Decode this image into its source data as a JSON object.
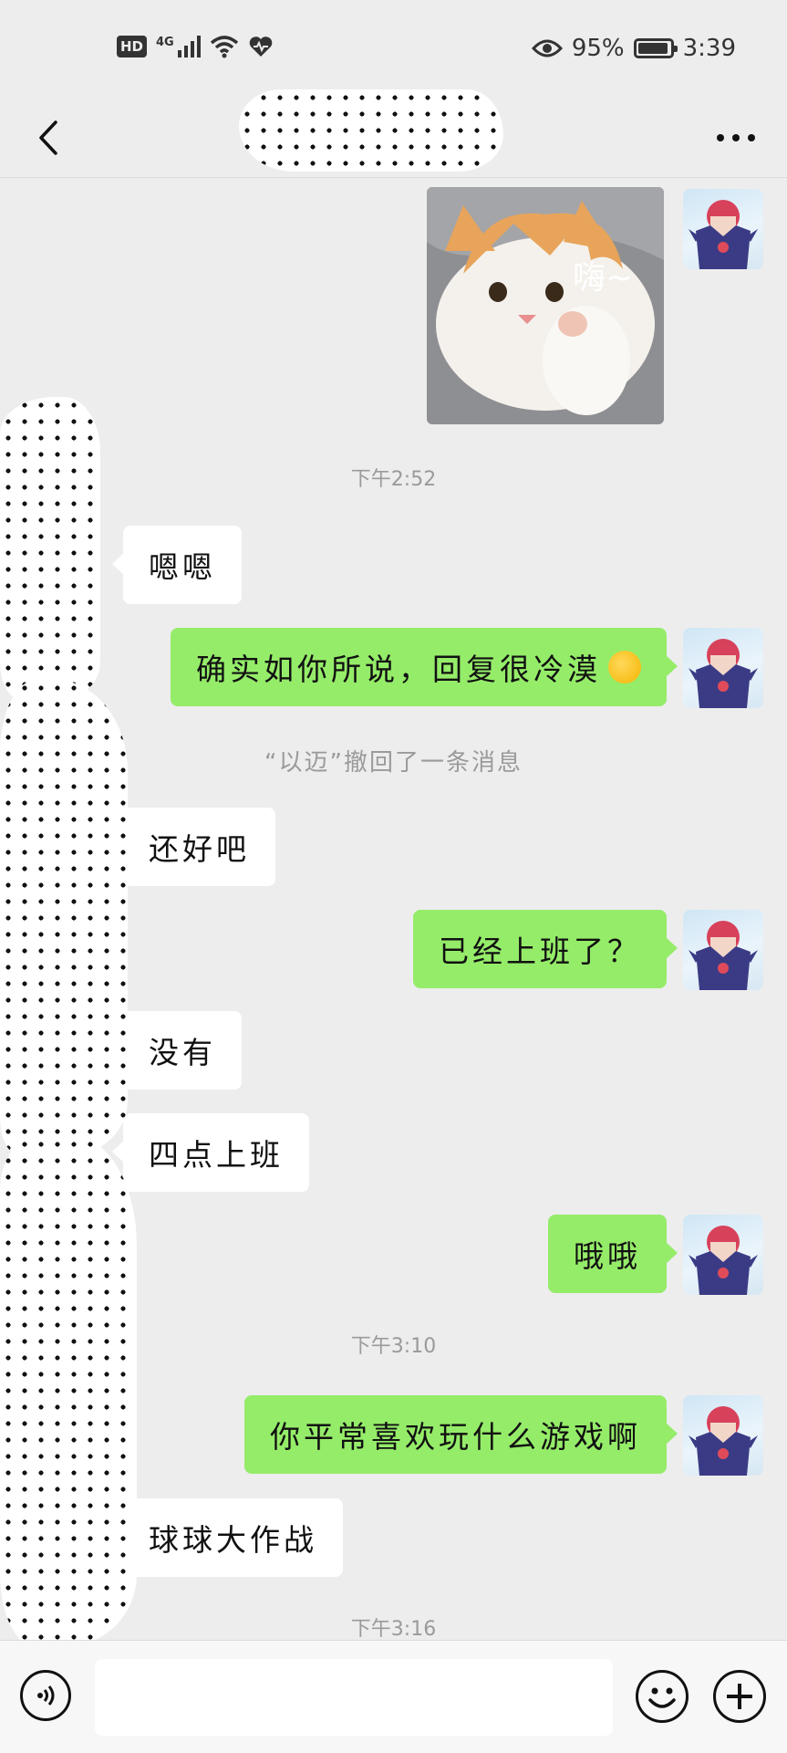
{
  "status_bar": {
    "hd": "HD",
    "network": "4G",
    "battery_percent": "95%",
    "battery_level": 0.95,
    "time": "3:39",
    "icons": [
      "hd-icon",
      "signal-icon",
      "wifi-icon",
      "heart-icon",
      "eye-icon",
      "battery-icon"
    ]
  },
  "header": {
    "title": "",
    "back_icon": "chevron-left-icon",
    "more_icon": "more-icon"
  },
  "messages": [
    {
      "type": "image",
      "side": "me",
      "caption": "嗨~"
    },
    {
      "type": "timestamp",
      "text": "下午2:52"
    },
    {
      "type": "text",
      "side": "them",
      "text": "嗯嗯"
    },
    {
      "type": "text",
      "side": "me",
      "text": "确实如你所说，回复很冷漠"
    },
    {
      "type": "system",
      "name": "“以迈”",
      "text": "撤回了一条消息"
    },
    {
      "type": "text",
      "side": "them",
      "text": "还好吧"
    },
    {
      "type": "text",
      "side": "me",
      "text": "已经上班了？"
    },
    {
      "type": "text",
      "side": "them",
      "text": "没有"
    },
    {
      "type": "text",
      "side": "them",
      "text": "四点上班"
    },
    {
      "type": "text",
      "side": "me",
      "text": "哦哦"
    },
    {
      "type": "timestamp",
      "text": "下午3:10"
    },
    {
      "type": "text",
      "side": "me",
      "text": "你平常喜欢玩什么游戏啊"
    },
    {
      "type": "text",
      "side": "them",
      "text": "球球大作战"
    },
    {
      "type": "timestamp",
      "text": "下午3:16"
    }
  ],
  "input_bar": {
    "placeholder": "",
    "voice_icon": "voice-icon",
    "emoji_icon": "emoji-icon",
    "plus_icon": "plus-icon"
  },
  "colors": {
    "background": "#ededed",
    "my_bubble": "#95ec69",
    "their_bubble": "#ffffff",
    "meta_text": "#9a9a9a"
  }
}
